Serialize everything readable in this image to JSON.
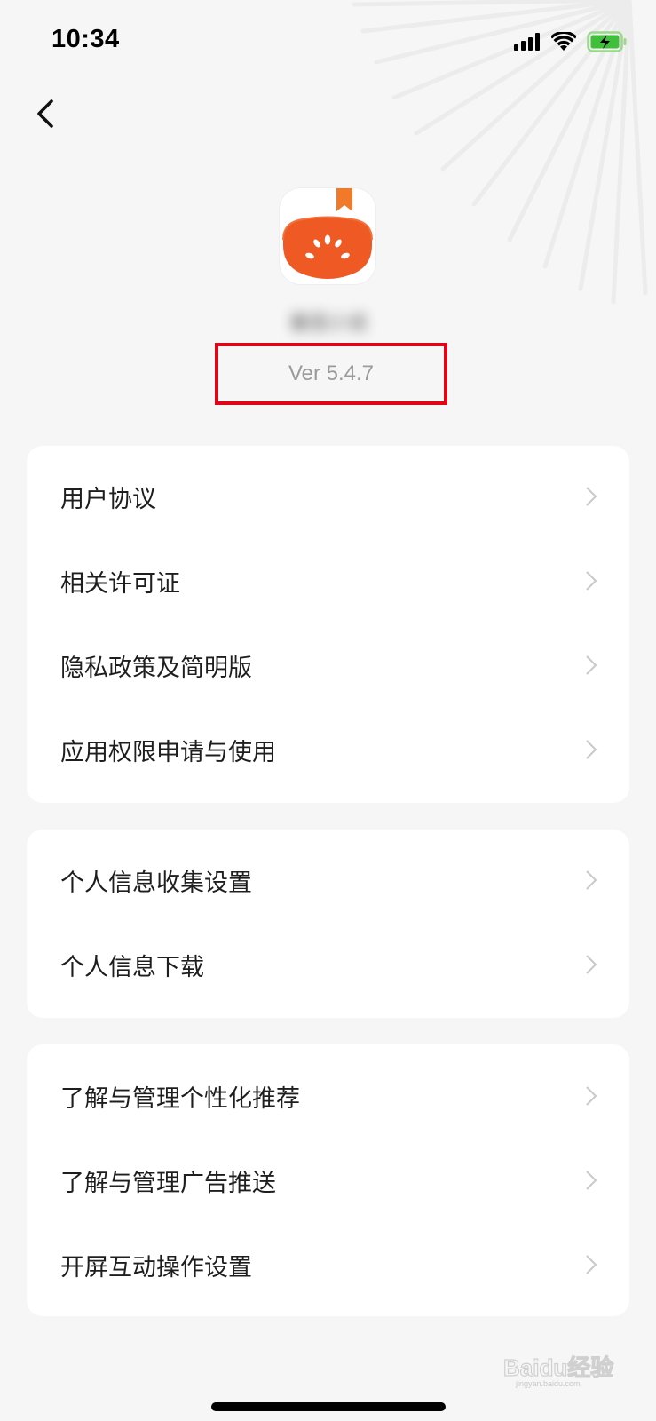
{
  "status_bar": {
    "time": "10:34"
  },
  "app": {
    "name": "番茄小说",
    "version": "Ver 5.4.7"
  },
  "sections": [
    {
      "items": [
        {
          "label": "用户协议"
        },
        {
          "label": "相关许可证"
        },
        {
          "label": "隐私政策及简明版"
        },
        {
          "label": "应用权限申请与使用"
        }
      ]
    },
    {
      "items": [
        {
          "label": "个人信息收集设置"
        },
        {
          "label": "个人信息下载"
        }
      ]
    },
    {
      "items": [
        {
          "label": "了解与管理个性化推荐"
        },
        {
          "label": "了解与管理广告推送"
        },
        {
          "label": "开屏互动操作设置"
        }
      ]
    }
  ],
  "watermark": {
    "text": "Baidu经验",
    "sub": "jingyan.baidu.com"
  },
  "colors": {
    "highlight": "#e0061a",
    "icon_orange": "#ef5a24",
    "bookmark": "#f07a2a"
  }
}
